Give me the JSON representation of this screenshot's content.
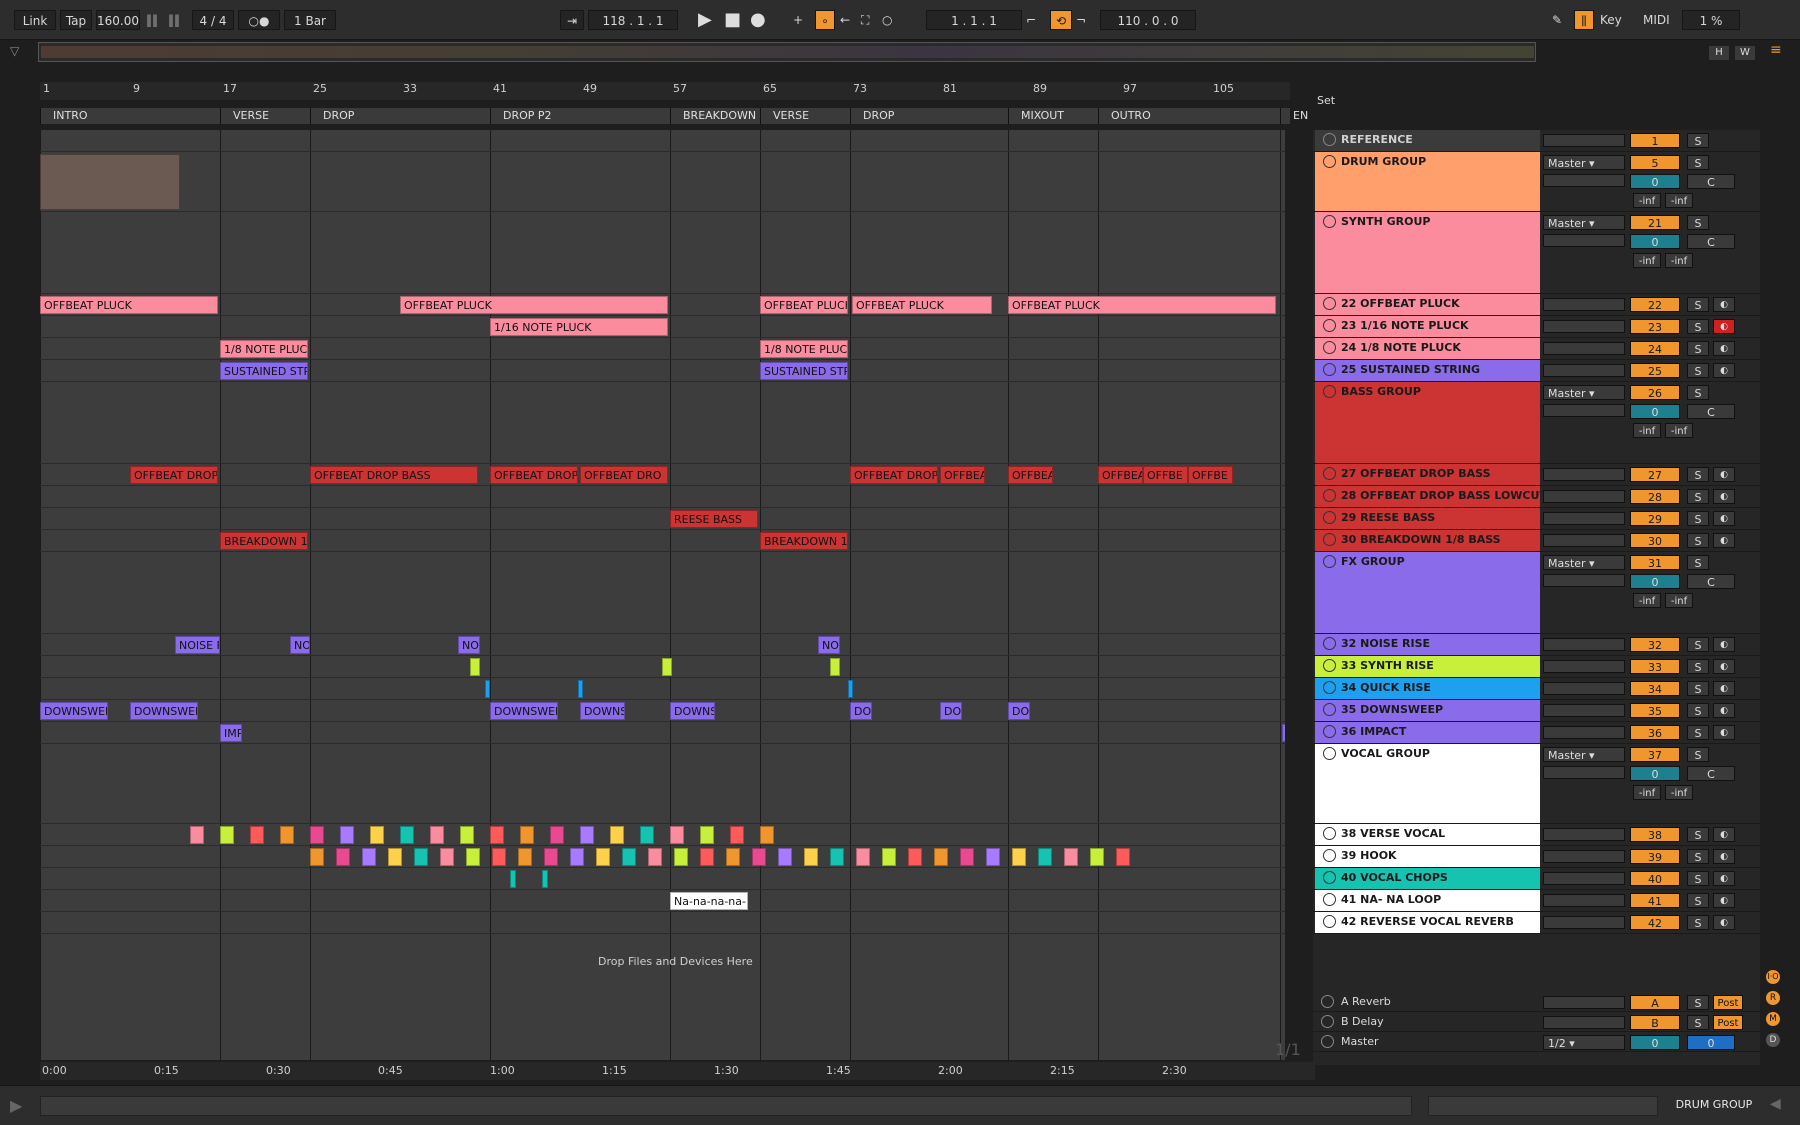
{
  "topbar": {
    "link": "Link",
    "tap": "Tap",
    "tempo": "160.00",
    "signature": "4 / 4",
    "quantize": "1 Bar",
    "position": "118 .  1 .  1",
    "loop_start": "1 .  1 .  1",
    "loop_length": "110 .  0 .  0",
    "key": "Key",
    "midi": "MIDI",
    "cpu": "1 %"
  },
  "overview": {
    "h": "H",
    "w": "W"
  },
  "set_label": "Set",
  "ruler": [
    "1",
    "9",
    "17",
    "25",
    "33",
    "41",
    "49",
    "57",
    "65",
    "73",
    "81",
    "89",
    "97",
    "105"
  ],
  "locators": [
    "INTRO",
    "VERSE",
    "DROP",
    "DROP P2",
    "BREAKDOWN",
    "VERSE",
    "DROP",
    "MIXOUT",
    "OUTRO",
    "EN"
  ],
  "drop_hint": "Drop Files and Devices Here",
  "page_counter": "1/1",
  "time_ruler": [
    "0:00",
    "0:15",
    "0:30",
    "0:45",
    "1:00",
    "1:15",
    "1:30",
    "1:45",
    "2:00",
    "2:15",
    "2:30"
  ],
  "clips": {
    "offbeat_pluck": "OFFBEAT PLUCK",
    "sixteenth_pluck": "1/16 NOTE PLUCK",
    "eighth_pluck": "1/8 NOTE PLUC",
    "sustained": "SUSTAINED STR",
    "offbeat_drop": "OFFBEAT DROP",
    "offbeat_drop_bass": "OFFBEAT DROP BASS",
    "offbeat_drop_2": "OFFBEAT DRO",
    "offbea": "OFFBEA",
    "offbe": "OFFBE",
    "reese": "REESE BASS",
    "breakdown": "BREAKDOWN 1/",
    "noise": "NOISE R",
    "noi": "NOI",
    "downsweep": "DOWNSWEI",
    "downs": "DOWNS",
    "dov": "DOV",
    "imp": "IMP",
    "nana": "Na-na-na-na-"
  },
  "tracks": [
    {
      "id": "reference",
      "name": "REFERENCE",
      "num": "1",
      "type": "audio",
      "color": "#3b3b3b",
      "text": "#d0d0d0"
    },
    {
      "id": "drum",
      "name": "DRUM GROUP",
      "num": "5",
      "type": "group",
      "color": "#ff9f6b",
      "text": "#1a1a1a",
      "routing": "Master",
      "vol": "0",
      "pan": "C",
      "inf": "-inf"
    },
    {
      "id": "synth",
      "name": "SYNTH GROUP",
      "num": "21",
      "type": "group",
      "color": "#fa8c9e",
      "text": "#1a1a1a",
      "routing": "Master",
      "vol": "0",
      "pan": "C",
      "inf": "-inf"
    },
    {
      "id": "t22",
      "name": "22 OFFBEAT PLUCK",
      "num": "22",
      "color": "#fa8c9e"
    },
    {
      "id": "t23",
      "name": "23 1/16 NOTE PLUCK",
      "num": "23",
      "color": "#fa8c9e"
    },
    {
      "id": "t24",
      "name": "24 1/8 NOTE PLUCK",
      "num": "24",
      "color": "#fa8c9e"
    },
    {
      "id": "t25",
      "name": "25 SUSTAINED STRING",
      "num": "25",
      "color": "#8a6bea"
    },
    {
      "id": "bass",
      "name": "BASS GROUP",
      "num": "26",
      "type": "group",
      "color": "#cc3333",
      "text": "#1a1a1a",
      "routing": "Master",
      "vol": "0",
      "pan": "C",
      "inf": "-inf"
    },
    {
      "id": "t27",
      "name": "27 OFFBEAT DROP BASS",
      "num": "27",
      "color": "#cc3333"
    },
    {
      "id": "t28",
      "name": "28 OFFBEAT DROP BASS LOWCUT",
      "num": "28",
      "color": "#cc3333"
    },
    {
      "id": "t29",
      "name": "29 REESE BASS",
      "num": "29",
      "color": "#cc3333"
    },
    {
      "id": "t30",
      "name": "30 BREAKDOWN 1/8 BASS",
      "num": "30",
      "color": "#cc3333"
    },
    {
      "id": "fx",
      "name": "FX GROUP",
      "num": "31",
      "type": "group",
      "color": "#8a6bea",
      "text": "#1a1a1a",
      "routing": "Master",
      "vol": "0",
      "pan": "C",
      "inf": "-inf"
    },
    {
      "id": "t32",
      "name": "32 NOISE RISE",
      "num": "32",
      "color": "#8a6bea"
    },
    {
      "id": "t33",
      "name": "33 SYNTH RISE",
      "num": "33",
      "color": "#c8f03a"
    },
    {
      "id": "t34",
      "name": "34 QUICK RISE",
      "num": "34",
      "color": "#1ea0f0"
    },
    {
      "id": "t35",
      "name": "35 DOWNSWEEP",
      "num": "35",
      "color": "#8a6bea"
    },
    {
      "id": "t36",
      "name": "36 IMPACT",
      "num": "36",
      "color": "#8a6bea"
    },
    {
      "id": "vocal",
      "name": "VOCAL GROUP",
      "num": "37",
      "type": "group",
      "color": "#ffffff",
      "text": "#1a1a1a",
      "routing": "Master",
      "vol": "0",
      "pan": "C",
      "inf": "-inf"
    },
    {
      "id": "t38",
      "name": "38 VERSE VOCAL",
      "num": "38",
      "color": "#ffffff"
    },
    {
      "id": "t39",
      "name": "39 HOOK",
      "num": "39",
      "color": "#ffffff"
    },
    {
      "id": "t40",
      "name": "40 VOCAL CHOPS",
      "num": "40",
      "color": "#16c3b0"
    },
    {
      "id": "t41",
      "name": "41 NA- NA LOOP",
      "num": "41",
      "color": "#ffffff"
    },
    {
      "id": "t42",
      "name": "42 REVERSE VOCAL REVERB",
      "num": "42",
      "color": "#ffffff"
    }
  ],
  "returns": [
    {
      "name": "A Reverb",
      "letter": "A",
      "post": "Post"
    },
    {
      "name": "B Delay",
      "letter": "B",
      "post": "Post"
    }
  ],
  "master": {
    "name": "Master",
    "routing": "1/2",
    "vol": "0",
    "pan": "0"
  },
  "button_s": "S",
  "status_track": "DRUM GROUP"
}
